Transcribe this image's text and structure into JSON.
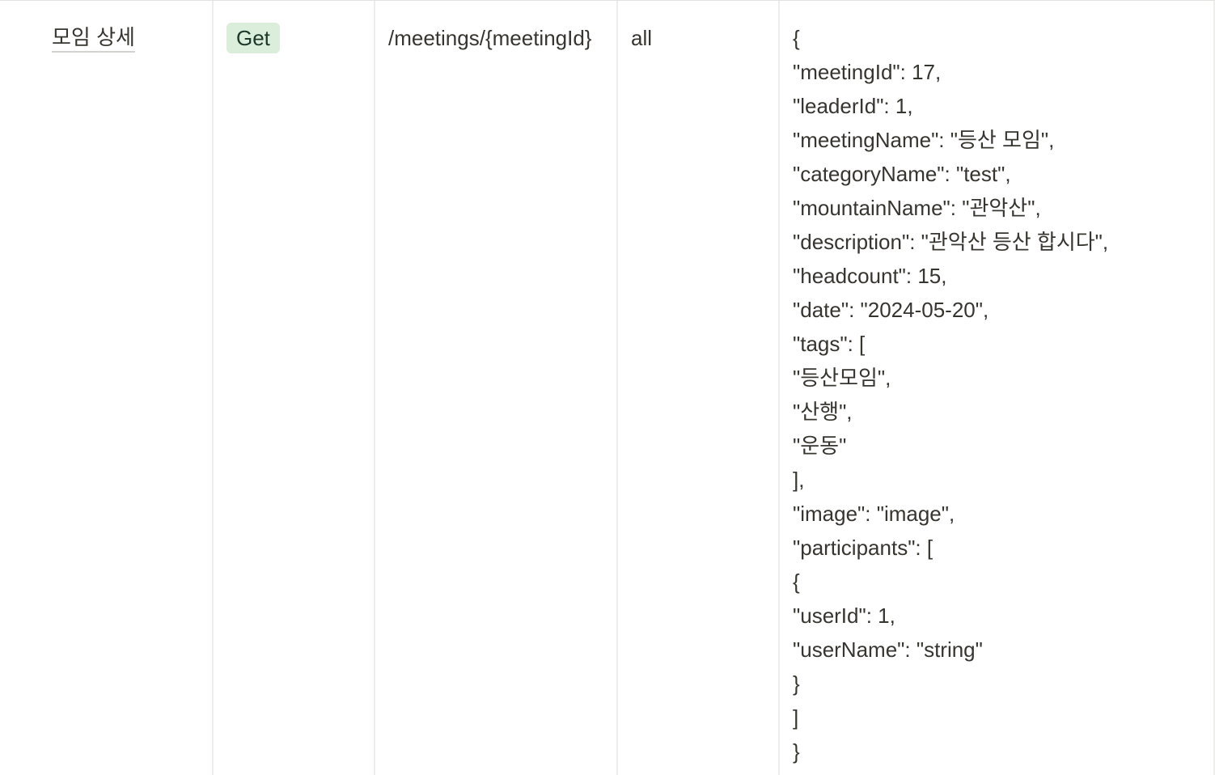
{
  "row": {
    "name": "모임 상세",
    "method": "Get",
    "path": "/meetings/{meetingId}",
    "auth": "all",
    "response_lines": [
      "{",
      "\"meetingId\": 17,",
      "\"leaderId\": 1,",
      "\"meetingName\": \"등산 모임\",",
      "\"categoryName\": \"test\",",
      "\"mountainName\": \"관악산\",",
      "\"description\": \"관악산 등산 합시다\",",
      "\"headcount\": 15,",
      "\"date\": \"2024-05-20\",",
      "\"tags\": [",
      "\"등산모임\",",
      "\"산행\",",
      "\"운동\"",
      "],",
      "\"image\": \"image\",",
      "\"participants\": [",
      "{",
      "\"userId\": 1,",
      "\"userName\": \"string\"",
      "}",
      "]",
      "}"
    ]
  },
  "colors": {
    "method_badge_bg": "#dbeddb",
    "method_badge_text": "#1c3829",
    "text": "#37352f",
    "grid": "#ededec"
  }
}
